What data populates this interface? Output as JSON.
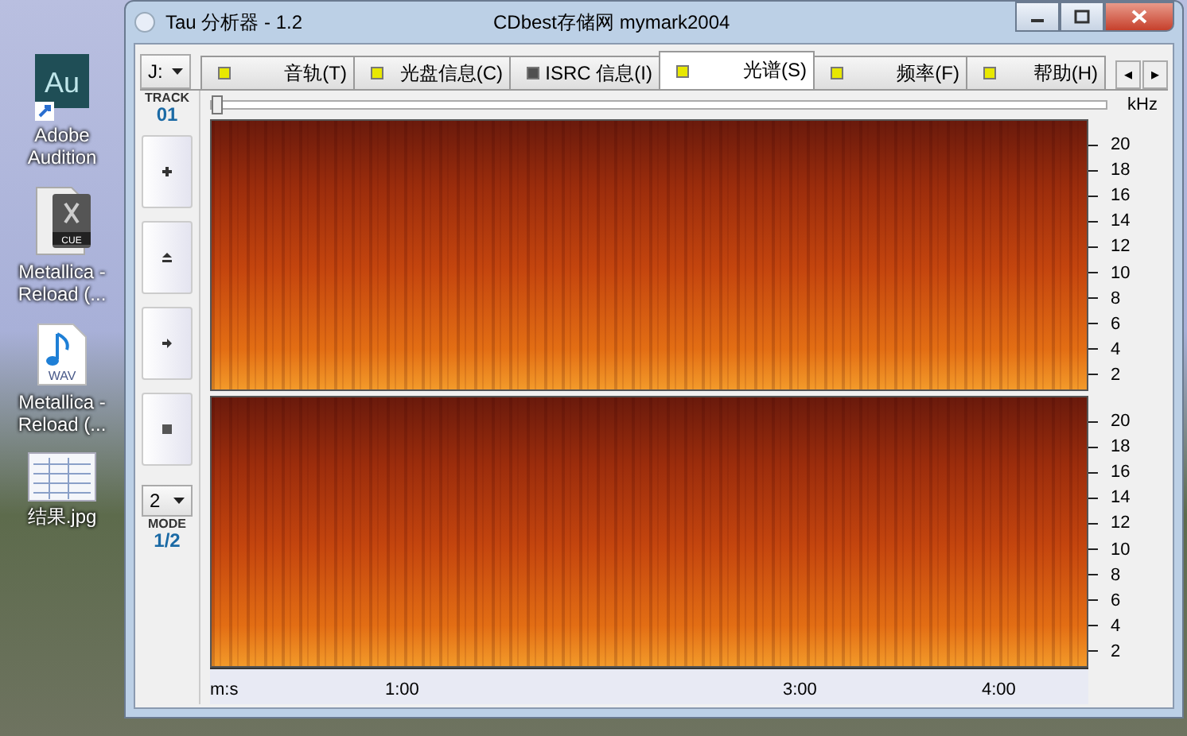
{
  "desktop": {
    "icons": [
      {
        "kind": "app",
        "badge": "Au",
        "label": "Adobe Audition"
      },
      {
        "kind": "cue",
        "badge": "CUE",
        "label": "Metallica - Reload (..."
      },
      {
        "kind": "wav",
        "badge": "WAV",
        "label": "Metallica - Reload (..."
      },
      {
        "kind": "image",
        "label": "结果.jpg"
      }
    ]
  },
  "window": {
    "title": "Tau 分析器 - 1.2",
    "subtitle": "CDbest存储网 mymark2004"
  },
  "drive": {
    "value": "J:",
    "caption": "TRACK",
    "track": "01"
  },
  "tabs": [
    {
      "label": "音轨(T)",
      "selected": false,
      "color": "#e8e800"
    },
    {
      "label": "光盘信息(C)",
      "selected": false,
      "color": "#e8e800"
    },
    {
      "label": "ISRC 信息(I)",
      "selected": false,
      "color": "#505050"
    },
    {
      "label": "光谱(S)",
      "selected": true,
      "color": "#e8e800"
    },
    {
      "label": "频率(F)",
      "selected": false,
      "color": "#e8e800"
    },
    {
      "label": "帮助(H)",
      "selected": false,
      "color": "#e8e800"
    }
  ],
  "tab_scroll": [
    "◂",
    "▸"
  ],
  "controls": [
    {
      "kind": "plus"
    },
    {
      "kind": "eject"
    },
    {
      "kind": "play"
    },
    {
      "kind": "stop"
    }
  ],
  "mode": {
    "value": "2",
    "caption": "MODE",
    "reading": "1/2"
  },
  "position_slider": {
    "level": 0
  },
  "frequency_scale": {
    "unit": "kHz",
    "channels": [
      [
        "20",
        "18",
        "16",
        "14",
        "12",
        "10",
        "8",
        "6",
        "4",
        "2"
      ],
      [
        "20",
        "18",
        "16",
        "14",
        "12",
        "10",
        "8",
        "6",
        "4",
        "2"
      ]
    ]
  },
  "time_axis": {
    "labels": [
      "m:s",
      "1:00",
      "3:00",
      "4:00"
    ]
  }
}
